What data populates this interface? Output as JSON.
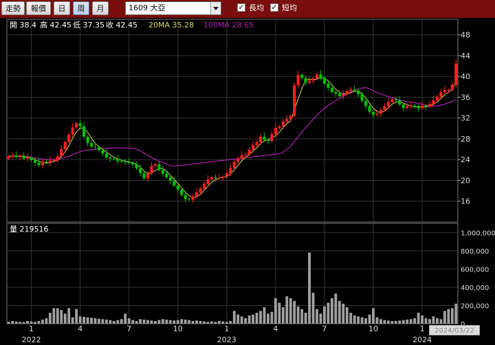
{
  "toolbar": {
    "buttons": [
      "走勢",
      "報價",
      "日",
      "周",
      "月"
    ],
    "active_index": 3,
    "symbol": "1609 大亞",
    "long_ma_label": "長均",
    "short_ma_label": "短均",
    "long_ma_checked": true,
    "short_ma_checked": true
  },
  "price_info": {
    "open": "開 38.4",
    "high": "高 42.45",
    "low": "低 37.35",
    "close": "收 42.45",
    "ma20": "20MA 35.28",
    "ma100": "100MA 28.65"
  },
  "volume_info": {
    "label": "量 219516"
  },
  "date_tag": "2024/03/22",
  "colors": {
    "up": "#ff2020",
    "down": "#00c000",
    "ma20": "#d8d860",
    "ma100": "#b020b0",
    "volume": "#a0a0a0",
    "grid": "#333333"
  },
  "chart_data": {
    "type": "candlestick-weekly",
    "price_ylim": [
      12,
      51
    ],
    "price_ticks": [
      16,
      20,
      24,
      28,
      32,
      36,
      40,
      44,
      48
    ],
    "volume_ylim": [
      0,
      1100000
    ],
    "volume_ticks": [
      "0",
      "200,000",
      "400,000",
      "600,000",
      "800,000",
      "1,000,000"
    ],
    "x_month_labels": [
      {
        "label": "1",
        "week": 6
      },
      {
        "label": "4",
        "week": 19
      },
      {
        "label": "7",
        "week": 32
      },
      {
        "label": "10",
        "week": 45
      },
      {
        "label": "1",
        "week": 58
      },
      {
        "label": "4",
        "week": 71
      },
      {
        "label": "7",
        "week": 84
      },
      {
        "label": "10",
        "week": 97
      },
      {
        "label": "1",
        "week": 110
      }
    ],
    "x_year_labels": [
      {
        "label": "2022",
        "week": 6
      },
      {
        "label": "2023",
        "week": 58
      },
      {
        "label": "2024",
        "week": 110
      }
    ],
    "closes": [
      24.6,
      24.8,
      24.5,
      24.8,
      24.2,
      24.4,
      23.9,
      23.4,
      22.9,
      23.6,
      23.4,
      23.8,
      23.9,
      24.6,
      26.0,
      27.4,
      28.8,
      30.2,
      31.0,
      30.4,
      28.4,
      27.2,
      26.5,
      26.4,
      25.8,
      25.2,
      24.4,
      24.2,
      24.1,
      23.7,
      23.6,
      23.5,
      23.4,
      23.1,
      22.3,
      21.4,
      20.4,
      21.3,
      22.8,
      23.1,
      22.0,
      21.3,
      20.6,
      19.9,
      19.0,
      18.2,
      17.2,
      16.4,
      16.3,
      16.9,
      17.7,
      18.4,
      19.3,
      20.2,
      20.6,
      20.4,
      20.5,
      20.7,
      21.4,
      22.4,
      23.6,
      24.2,
      24.9,
      25.0,
      25.9,
      26.8,
      27.4,
      28.4,
      27.8,
      27.6,
      28.9,
      30.1,
      30.4,
      31.3,
      31.8,
      32.4,
      38.3,
      40.3,
      39.7,
      38.8,
      39.2,
      39.6,
      40.4,
      39.8,
      38.6,
      37.8,
      37.0,
      36.7,
      36.2,
      36.6,
      37.2,
      37.5,
      37.3,
      36.6,
      35.3,
      34.3,
      33.2,
      32.6,
      32.8,
      33.6,
      34.3,
      35.1,
      35.6,
      35.4,
      34.6,
      33.9,
      34.3,
      34.4,
      34.1,
      33.9,
      34.4,
      34.2,
      34.7,
      35.4,
      36.1,
      37.0,
      37.4,
      37.4,
      38.4,
      42.45
    ],
    "volumes": [
      20000,
      30000,
      25000,
      20000,
      18000,
      30000,
      25000,
      20000,
      30000,
      45000,
      60000,
      120000,
      170000,
      170000,
      150000,
      110000,
      170000,
      70000,
      160000,
      80000,
      75000,
      70000,
      65000,
      60000,
      55000,
      50000,
      45000,
      40000,
      30000,
      40000,
      50000,
      110000,
      60000,
      40000,
      30000,
      50000,
      45000,
      40000,
      35000,
      30000,
      40000,
      50000,
      45000,
      40000,
      35000,
      40000,
      50000,
      45000,
      40000,
      30000,
      35000,
      30000,
      25000,
      20000,
      25000,
      20000,
      30000,
      25000,
      20000,
      30000,
      140000,
      100000,
      80000,
      60000,
      90000,
      100000,
      120000,
      140000,
      180000,
      110000,
      130000,
      280000,
      230000,
      180000,
      300000,
      280000,
      250000,
      190000,
      160000,
      120000,
      780000,
      340000,
      160000,
      110000,
      190000,
      230000,
      280000,
      330000,
      250000,
      220000,
      180000,
      120000,
      90000,
      80000,
      70000,
      60000,
      100000,
      170000,
      70000,
      50000,
      40000,
      35000,
      30000,
      30000,
      35000,
      40000,
      45000,
      50000,
      60000,
      120000,
      90000,
      60000,
      50000,
      80000,
      60000,
      50000,
      140000,
      160000,
      170000,
      219516
    ]
  }
}
